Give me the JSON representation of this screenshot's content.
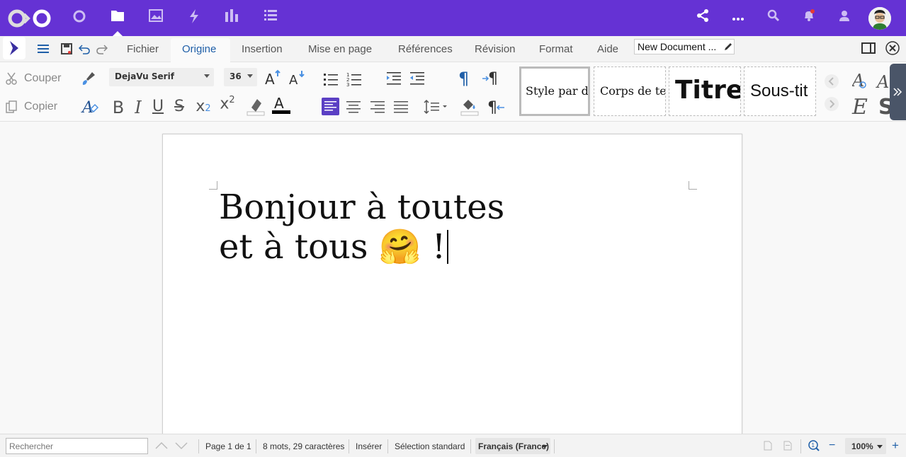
{
  "topbar": {
    "icons": [
      "app-logo",
      "circle-icon",
      "files-icon",
      "photos-icon",
      "activity-icon",
      "dashboard-icon",
      "tasks-icon"
    ],
    "right_icons": [
      "share-icon",
      "more-icon",
      "search-icon",
      "notifications-icon",
      "contacts-icon"
    ],
    "accent": "#6532d4"
  },
  "menubar": {
    "tabs": [
      "Fichier",
      "Origine",
      "Insertion",
      "Mise en page",
      "Références",
      "Révision",
      "Format",
      "Aide"
    ],
    "active_tab": "Origine",
    "document_name": "New Document ..."
  },
  "toolbar": {
    "cut": "Couper",
    "copy": "Copier",
    "font_name": "DejaVu Serif",
    "font_size": "36",
    "styles": [
      "Style par d",
      "Corps de te",
      "Titre",
      "Sous-tit"
    ]
  },
  "document": {
    "line1": "Bonjour à toutes",
    "line2": "et à tous 🤗 !"
  },
  "statusbar": {
    "search_placeholder": "Rechercher",
    "page": "Page 1 de 1",
    "counts": "8 mots, 29 caractères",
    "insert_mode": "Insérer",
    "selection_mode": "Sélection standard",
    "language": "Français (France)",
    "zoom": "100%"
  }
}
